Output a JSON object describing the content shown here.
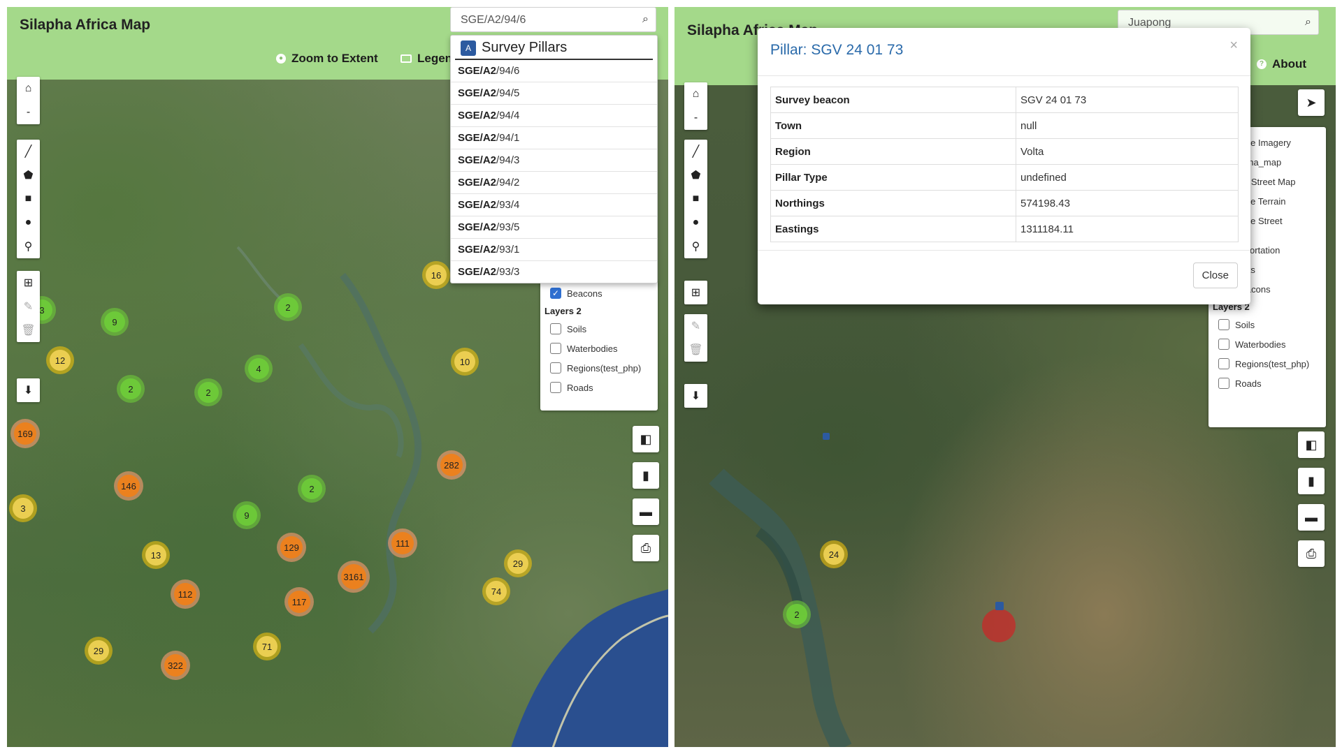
{
  "left": {
    "app_title": "Silapha Africa Map",
    "nav": {
      "zoom_extent": "Zoom to Extent",
      "legend": "Legen"
    },
    "search": {
      "value": "SGE/A2/94/6"
    },
    "dropdown": {
      "header": "Survey Pillars",
      "items": [
        {
          "bold": "SGE/A2",
          "rest": "/94/6"
        },
        {
          "bold": "SGE/A2",
          "rest": "/94/5"
        },
        {
          "bold": "SGE/A2",
          "rest": "/94/4"
        },
        {
          "bold": "SGE/A2",
          "rest": "/94/1"
        },
        {
          "bold": "SGE/A2",
          "rest": "/94/3"
        },
        {
          "bold": "SGE/A2",
          "rest": "/94/2"
        },
        {
          "bold": "SGE/A2",
          "rest": "/93/4"
        },
        {
          "bold": "SGE/A2",
          "rest": "/93/5"
        },
        {
          "bold": "SGE/A2",
          "rest": "/93/1"
        },
        {
          "bold": "SGE/A2",
          "rest": "/93/3"
        }
      ]
    },
    "layers": {
      "beacons": "Beacons",
      "group2": "Layers 2",
      "soils": "Soils",
      "waterbodies": "Waterbodies",
      "regions": "Regions(test_php)",
      "roads": "Roads"
    },
    "clusters": [
      {
        "label": "16",
        "color": "yellow"
      },
      {
        "label": "9",
        "color": "green"
      },
      {
        "label": "2",
        "color": "green"
      },
      {
        "label": "3",
        "color": "green"
      },
      {
        "label": "12",
        "color": "yellow"
      },
      {
        "label": "4",
        "color": "green"
      },
      {
        "label": "10",
        "color": "yellow"
      },
      {
        "label": "2",
        "color": "green"
      },
      {
        "label": "2",
        "color": "green"
      },
      {
        "label": "169",
        "color": "orange"
      },
      {
        "label": "282",
        "color": "orange"
      },
      {
        "label": "146",
        "color": "orange"
      },
      {
        "label": "2",
        "color": "green"
      },
      {
        "label": "3",
        "color": "yellow"
      },
      {
        "label": "9",
        "color": "green"
      },
      {
        "label": "111",
        "color": "orange"
      },
      {
        "label": "13",
        "color": "yellow"
      },
      {
        "label": "129",
        "color": "orange"
      },
      {
        "label": "29",
        "color": "yellow"
      },
      {
        "label": "3161",
        "color": "orange"
      },
      {
        "label": "74",
        "color": "yellow"
      },
      {
        "label": "112",
        "color": "orange"
      },
      {
        "label": "117",
        "color": "orange"
      },
      {
        "label": "29",
        "color": "yellow"
      },
      {
        "label": "71",
        "color": "yellow"
      },
      {
        "label": "322",
        "color": "orange"
      }
    ]
  },
  "right": {
    "app_title": "Silapha Africa Map",
    "search": {
      "value": "Juapong"
    },
    "nav": {
      "about": "About"
    },
    "layers": {
      "basemaps": [
        "gle Imagery",
        "pha_map",
        "n Street Map",
        "gle Terrain",
        "gle Street"
      ],
      "transportation": "nsportation",
      "ports": "ports",
      "beacons": "Beacons",
      "group2": "Layers 2",
      "soils": "Soils",
      "waterbodies": "Waterbodies",
      "regions": "Regions(test_php)",
      "roads": "Roads"
    },
    "clusters": [
      {
        "label": "24",
        "color": "yellow"
      },
      {
        "label": "2",
        "color": "green"
      }
    ],
    "modal": {
      "title": "Pillar: SGV 24 01 73",
      "close_x": "×",
      "close_label": "Close",
      "rows": [
        {
          "key": "Survey beacon",
          "value": "SGV 24 01 73"
        },
        {
          "key": "Town",
          "value": "null"
        },
        {
          "key": "Region",
          "value": "Volta"
        },
        {
          "key": "Pillar Type",
          "value": "undefined"
        },
        {
          "key": "Northings",
          "value": "574198.43"
        },
        {
          "key": "Eastings",
          "value": "1311184.11"
        }
      ]
    }
  }
}
